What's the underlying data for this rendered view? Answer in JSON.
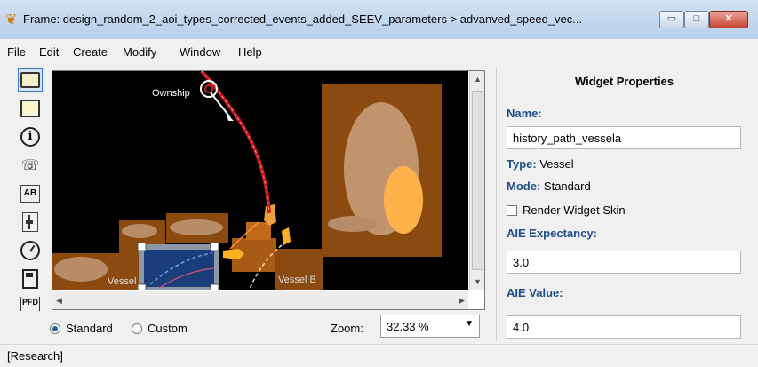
{
  "window": {
    "title": "Frame: design_random_2_aoi_types_corrected_events_added_SEEV_parameters > advanved_speed_vec...",
    "minimize": "▭",
    "maximize": "□",
    "close": "✕"
  },
  "menu": [
    "File",
    "Edit",
    "Create",
    "Modify",
    "Window",
    "Help"
  ],
  "toolbar": [
    {
      "icon": "panel-icon"
    },
    {
      "icon": "blank-panel-icon"
    },
    {
      "icon": "info-icon"
    },
    {
      "icon": "phone-icon"
    },
    {
      "icon": "ab-icon"
    },
    {
      "icon": "slider-icon"
    },
    {
      "icon": "gauge-icon"
    },
    {
      "icon": "fuel-icon"
    },
    {
      "icon": "pfd-icon",
      "label": "PFD"
    }
  ],
  "canvas": {
    "labels": {
      "ownship": "Ownship",
      "vessel": "Vessel",
      "vessel_b": "Vessel B"
    }
  },
  "view_mode": {
    "standard": "Standard",
    "custom": "Custom",
    "selected": "Standard"
  },
  "zoom": {
    "label": "Zoom:",
    "value": "32.33 %"
  },
  "status": "[Research]",
  "properties": {
    "title": "Widget Properties",
    "name_label": "Name:",
    "name_value": "history_path_vessela",
    "type_label": "Type:",
    "type_value": "Vessel",
    "mode_label": "Mode:",
    "mode_value": "Standard",
    "render_skin": "Render Widget Skin",
    "aie_expectancy_label": "AIE Expectancy:",
    "aie_expectancy_value": "3.0",
    "aie_value_label": "AIE Value:",
    "aie_value_value": "4.0"
  }
}
